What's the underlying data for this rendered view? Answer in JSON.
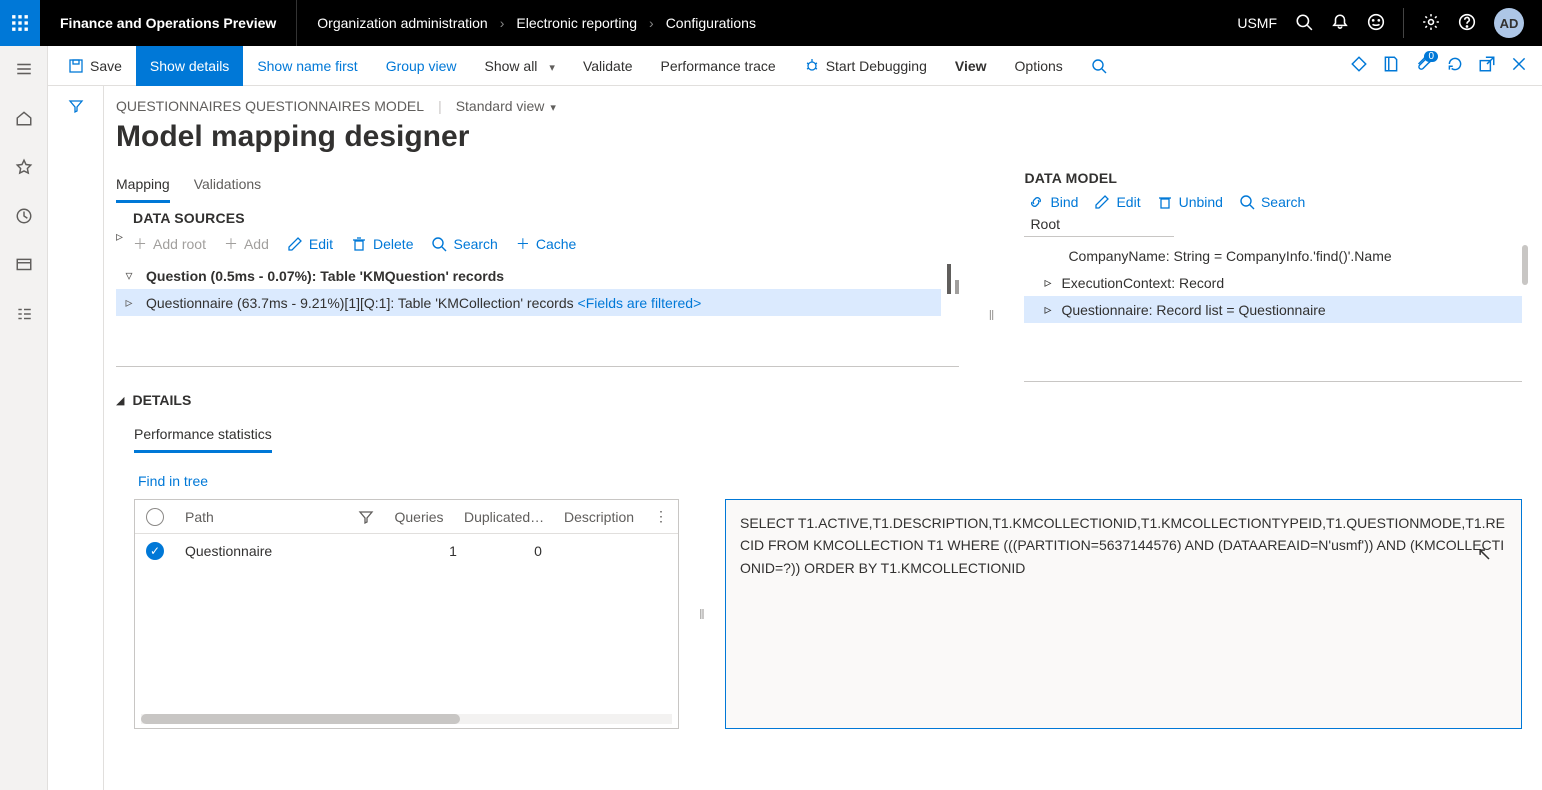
{
  "topbar": {
    "app_title": "Finance and Operations Preview",
    "breadcrumb": [
      "Organization administration",
      "Electronic reporting",
      "Configurations"
    ],
    "company": "USMF",
    "avatar": "AD"
  },
  "action_bar": {
    "save": "Save",
    "show_details": "Show details",
    "show_name_first": "Show name first",
    "group_view": "Group view",
    "show_all": "Show all",
    "validate": "Validate",
    "perf_trace": "Performance trace",
    "start_debug": "Start Debugging",
    "view": "View",
    "options": "Options",
    "attach_badge": "0"
  },
  "context": {
    "model_name": "QUESTIONNAIRES QUESTIONNAIRES MODEL",
    "view_name": "Standard view"
  },
  "page_title": "Model mapping designer",
  "tabs": {
    "mapping": "Mapping",
    "validations": "Validations"
  },
  "data_sources": {
    "title": "DATA SOURCES",
    "buttons": {
      "add_root": "Add root",
      "add": "Add",
      "edit": "Edit",
      "delete": "Delete",
      "search": "Search",
      "cache": "Cache"
    },
    "rows": [
      {
        "label": "Question (0.5ms - 0.07%): Table 'KMQuestion' records",
        "selected": false
      },
      {
        "label": "Questionnaire (63.7ms - 9.21%)[1][Q:1]: Table 'KMCollection' records ",
        "filtered": "<Fields are filtered>",
        "selected": true
      }
    ]
  },
  "data_model": {
    "title": "DATA MODEL",
    "buttons": {
      "bind": "Bind",
      "edit": "Edit",
      "unbind": "Unbind",
      "search": "Search"
    },
    "root": "Root",
    "rows": [
      {
        "label": "CompanyName: String = CompanyInfo.'find()'.Name",
        "bold": true,
        "selected": false,
        "expander": ""
      },
      {
        "label": "ExecutionContext: Record",
        "bold": false,
        "selected": false,
        "expander": "▹"
      },
      {
        "label": "Questionnaire: Record list = Questionnaire",
        "bold": false,
        "selected": true,
        "expander": "▹"
      }
    ]
  },
  "details": {
    "title": "DETAILS",
    "perf_tab": "Performance statistics",
    "find_in_tree": "Find in tree",
    "grid": {
      "headers": {
        "path": "Path",
        "queries": "Queries",
        "duplicated": "Duplicated…",
        "description": "Description"
      },
      "rows": [
        {
          "path": "Questionnaire",
          "queries": "1",
          "duplicated": "0",
          "selected": true
        }
      ]
    },
    "sql": "SELECT T1.ACTIVE,T1.DESCRIPTION,T1.KMCOLLECTIONID,T1.KMCOLLECTIONTYPEID,T1.QUESTIONMODE,T1.RECID FROM KMCOLLECTION T1 WHERE (((PARTITION=5637144576) AND (DATAAREAID=N'usmf')) AND (KMCOLLECTIONID=?)) ORDER BY T1.KMCOLLECTIONID"
  }
}
